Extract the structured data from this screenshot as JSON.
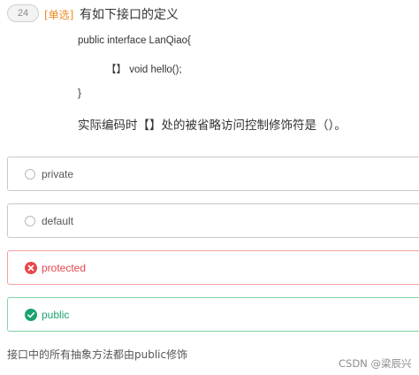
{
  "question": {
    "number": "24",
    "type": "[单选]",
    "title": "有如下接口的定义",
    "code": [
      "public interface LanQiao{",
      "【】 void hello();",
      "}"
    ],
    "prompt": "实际编码时【】处的被省略访问控制修饰符是（）。"
  },
  "options": [
    {
      "label": "private",
      "state": "unselected"
    },
    {
      "label": "default",
      "state": "unselected"
    },
    {
      "label": "protected",
      "state": "wrong"
    },
    {
      "label": "public",
      "state": "correct"
    }
  ],
  "explanation": "接口中的所有抽象方法都由public修饰",
  "watermark": "CSDN @梁辰兴",
  "colors": {
    "type_tag": "#ef8a23",
    "wrong": "#e5484d",
    "correct": "#1aa36b"
  },
  "icons": {
    "wrong": "close-circle-icon",
    "correct": "check-circle-icon"
  }
}
